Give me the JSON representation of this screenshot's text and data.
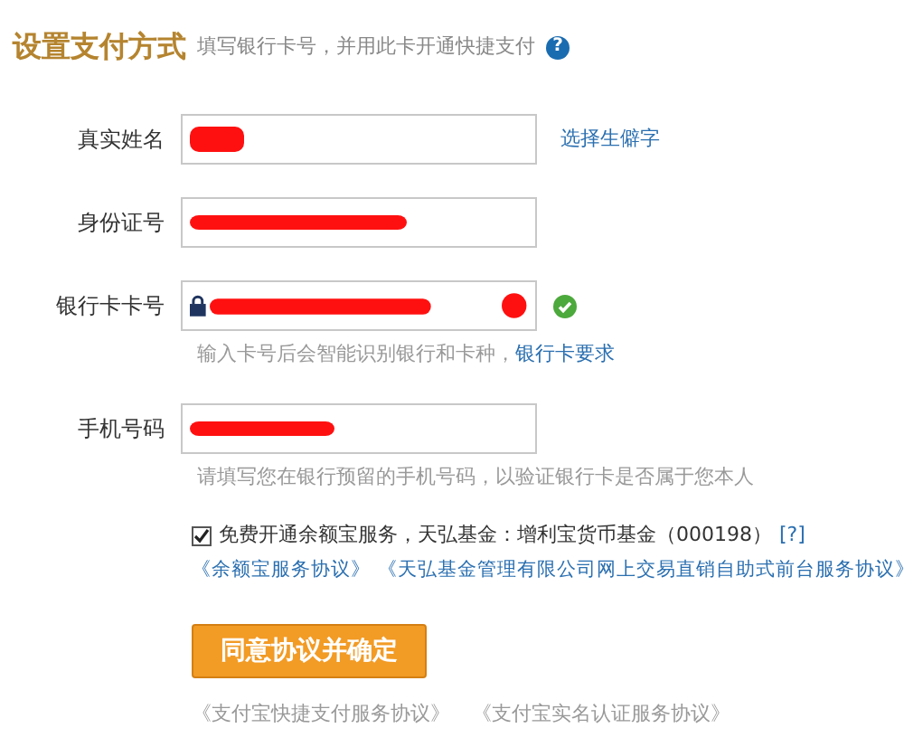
{
  "header": {
    "title": "设置支付方式",
    "subtitle": "填写银行卡号，并用此卡开通快捷支付",
    "help": "?"
  },
  "fields": [
    {
      "kind": "text",
      "label": "真实姓名",
      "redacted": true,
      "lock": false,
      "valid": false,
      "side_link": "选择生僻字"
    },
    {
      "kind": "text",
      "label": "身份证号",
      "redacted": true,
      "lock": false,
      "valid": false
    },
    {
      "kind": "card",
      "label": "银行卡卡号",
      "redacted": true,
      "lock": true,
      "valid": true,
      "hint": "输入卡号后会智能识别银行和卡种，",
      "hint_link": "银行卡要求"
    },
    {
      "kind": "text",
      "label": "手机号码",
      "redacted": true,
      "lock": false,
      "valid": false,
      "hint": "请填写您在银行预留的手机号码，以验证银行卡是否属于您本人"
    }
  ],
  "fund": {
    "checked": true,
    "text": "免费开通余额宝服务，天弘基金：增利宝货币基金（000198）",
    "help": "[?]",
    "links": [
      "《余额宝服务协议》",
      "《天弘基金管理有限公司网上交易直销自助式前台服务协议》"
    ]
  },
  "submit": "同意协议并确定",
  "footer_links": [
    "《支付宝快捷支付服务协议》",
    "《支付宝实名认证服务协议》"
  ]
}
